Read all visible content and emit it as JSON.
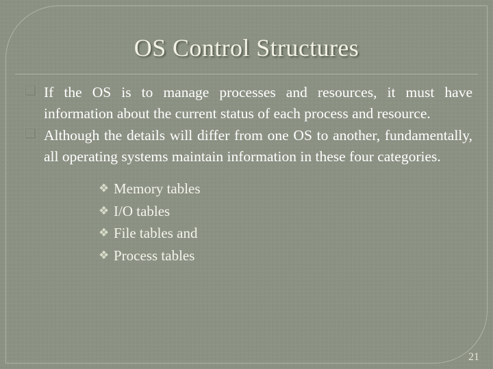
{
  "slide": {
    "title": "OS Control Structures",
    "page_number": "21",
    "background_color": "#8b9183",
    "title_color": "#f2f2e4",
    "body_text_color": "#ffffff",
    "level1_marker": "❑",
    "level2_marker": "❖",
    "bullets": [
      {
        "marker": "❑",
        "text": "If the OS is to manage processes and resources, it must have information about the current status of each process and resource."
      },
      {
        "marker": "❖",
        "text": "Although the details will differ from one OS to another, fundamentally, all operating systems maintain information in these four categories."
      }
    ],
    "sub_bullets": [
      {
        "marker": "❖",
        "text": "Memory tables"
      },
      {
        "marker": "❖",
        "text": "I/O tables"
      },
      {
        "marker": "❖",
        "text": "File tables and"
      },
      {
        "marker": "❖",
        "text": "Process tables"
      }
    ]
  }
}
